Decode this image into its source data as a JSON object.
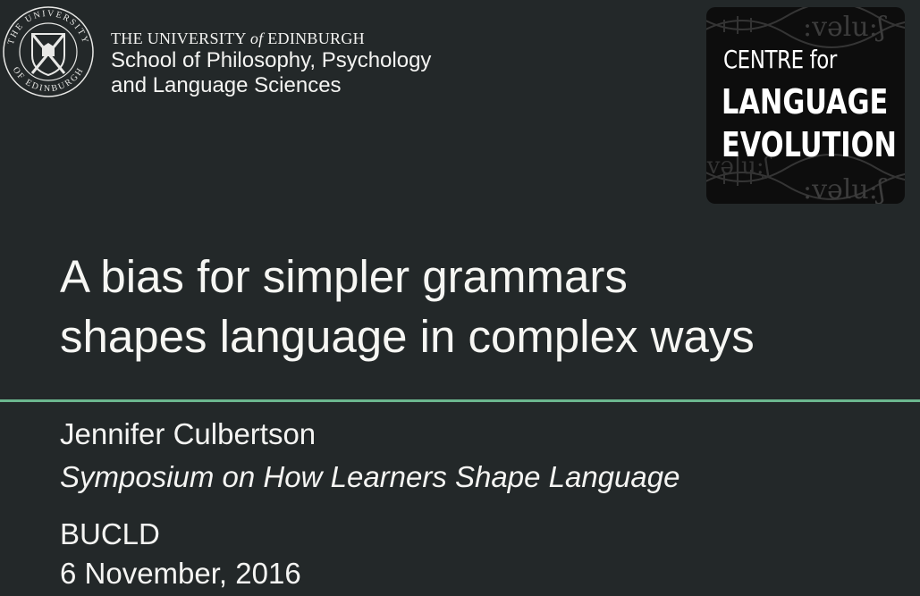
{
  "header": {
    "university_seal": {
      "ring_text_top": "THE UNIVERSITY",
      "ring_text_bottom": "OF EDINBURGH"
    },
    "university": {
      "prefix": "THE UNIVERSITY ",
      "of": "of",
      "suffix": " EDINBURGH"
    },
    "school_line1": "School of Philosophy, Psychology",
    "school_line2": "and Language Sciences"
  },
  "centre_logo": {
    "line1": "CENTRE for",
    "line2": "LANGUAGE",
    "line3": "EVOLUTION",
    "background_phonetic": ":vəlu:ʃ"
  },
  "title": {
    "line1": "A bias for simpler grammars",
    "line2": "shapes language in complex ways"
  },
  "details": {
    "author": "Jennifer Culbertson",
    "symposium": "Symposium on How Learners Shape Language",
    "venue": "BUCLD",
    "date": "6 November, 2016"
  },
  "colors": {
    "background": "#232829",
    "accent_divider": "#6cb88f",
    "text": "#f4f4f2"
  }
}
